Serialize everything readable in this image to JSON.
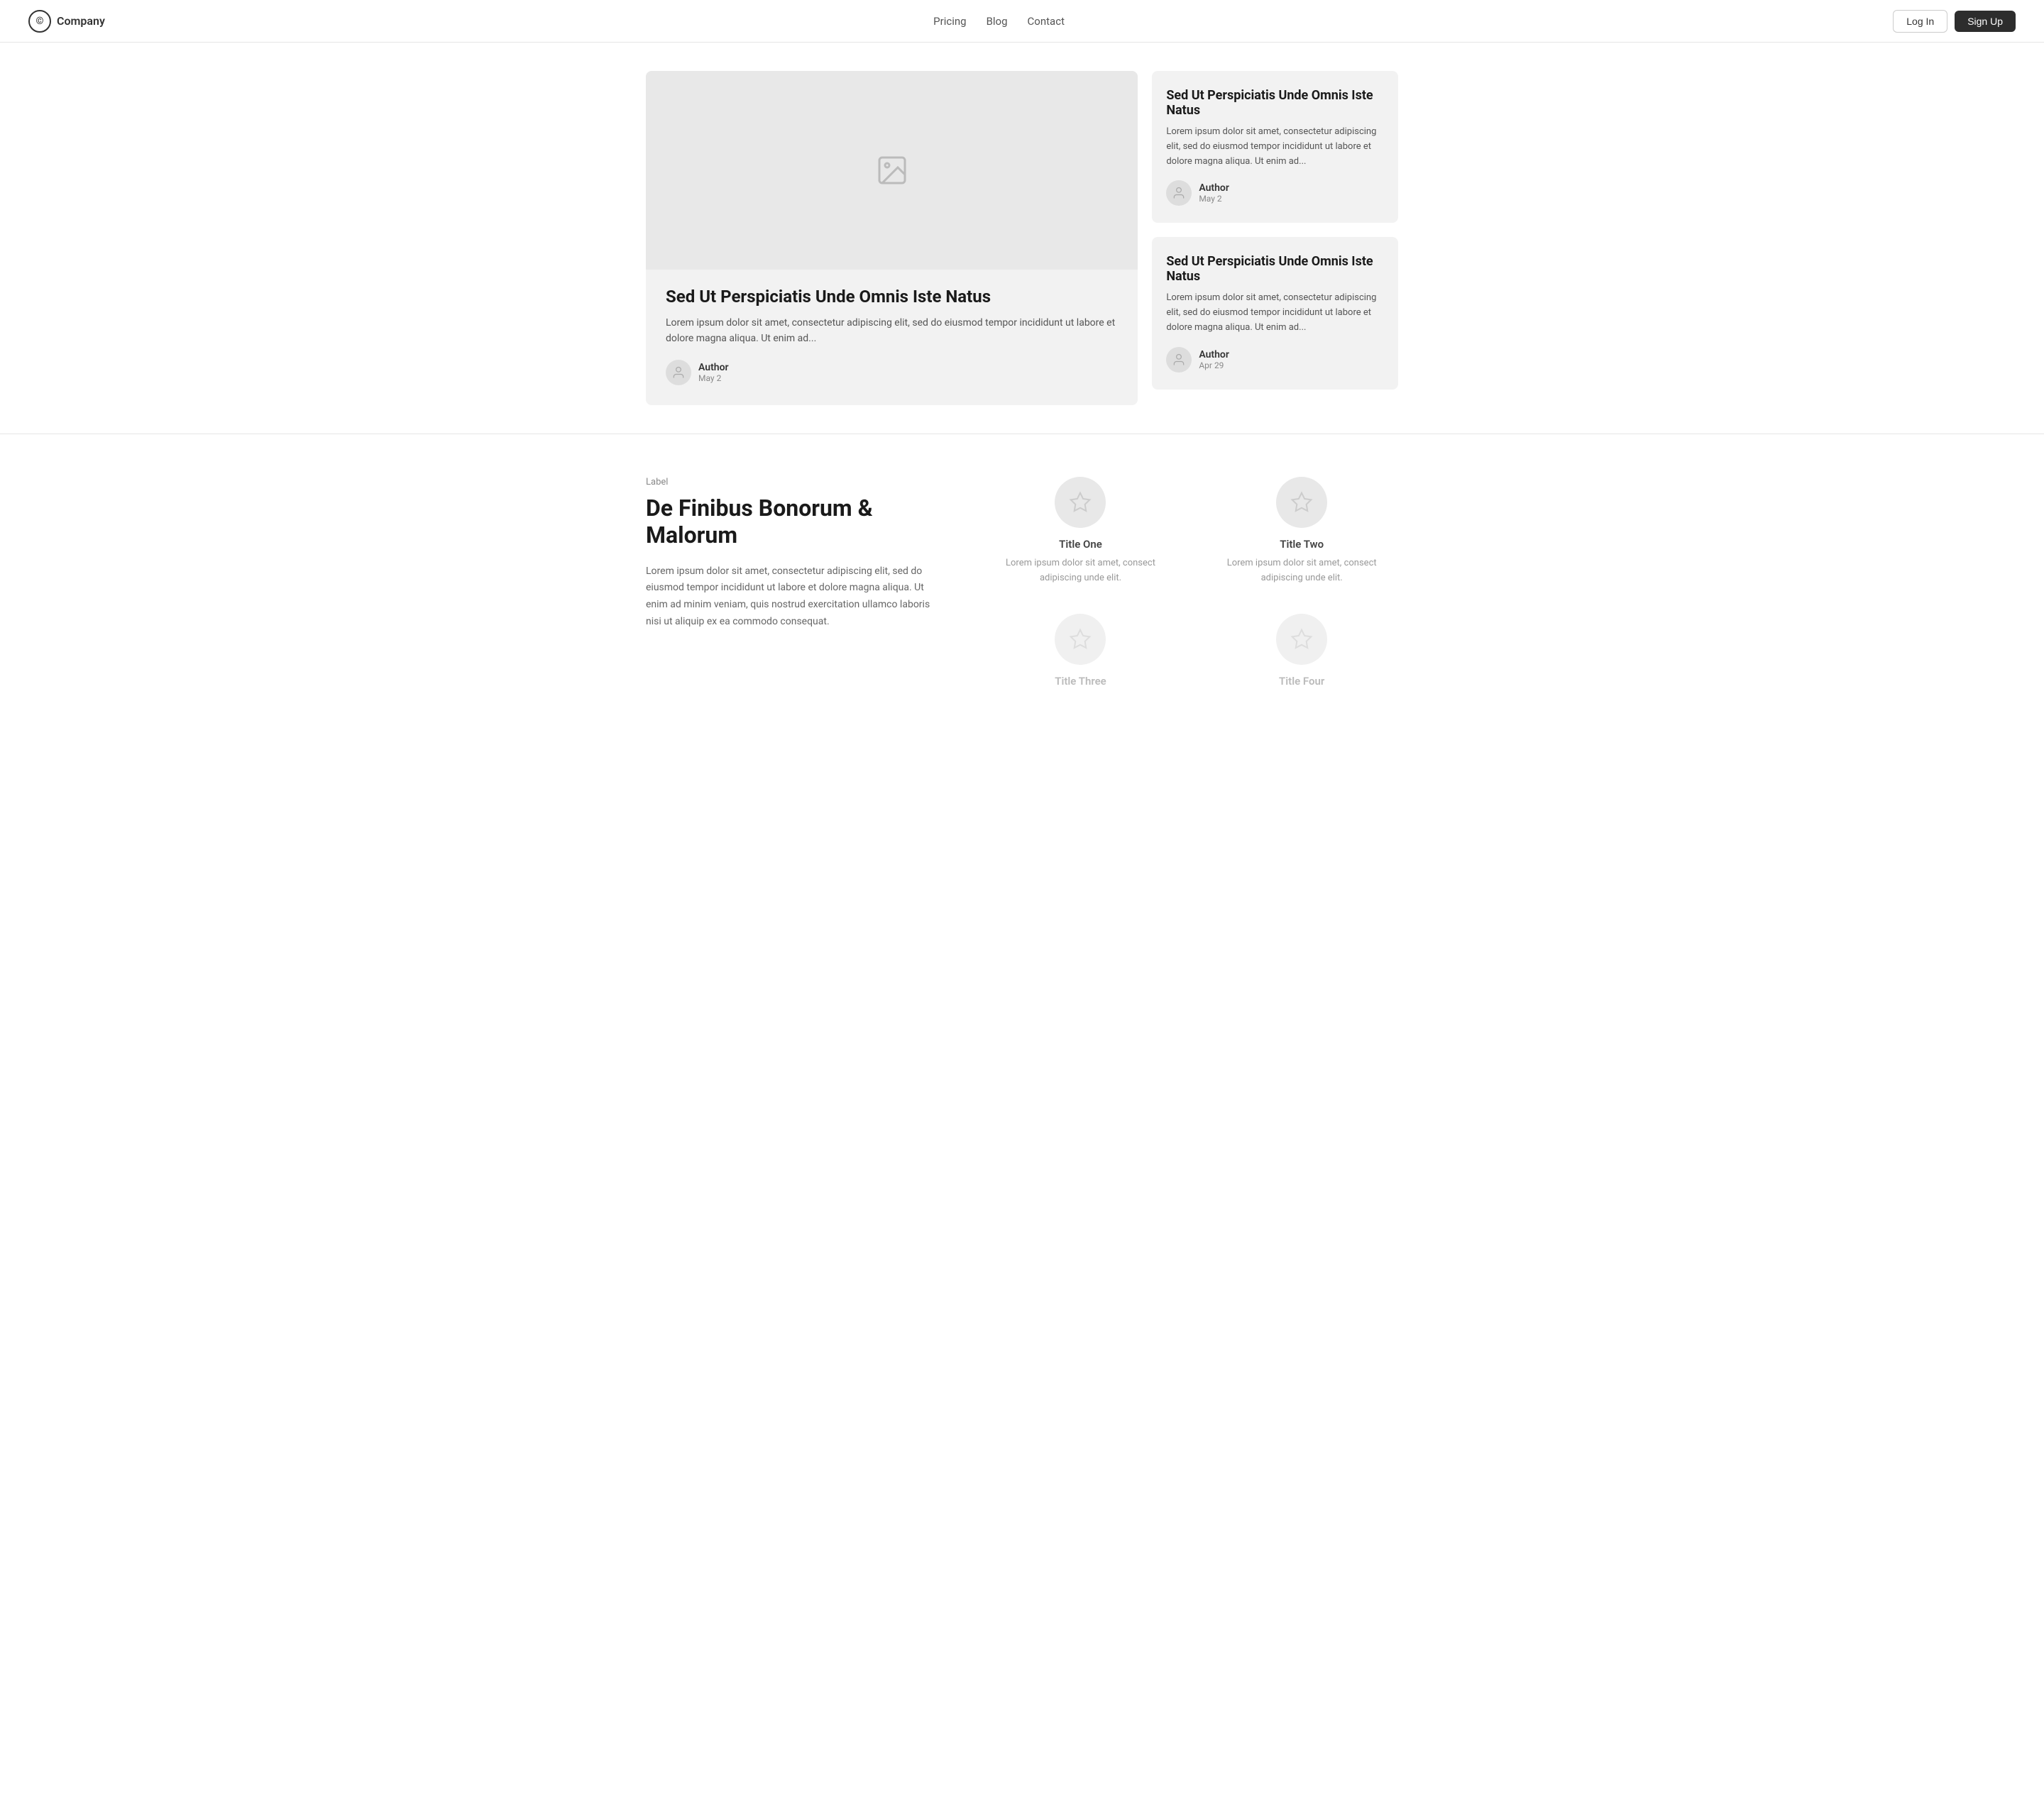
{
  "navbar": {
    "brand_icon": "©",
    "brand_name": "Company",
    "nav_links": [
      {
        "label": "Pricing",
        "id": "pricing"
      },
      {
        "label": "Blog",
        "id": "blog"
      },
      {
        "label": "Contact",
        "id": "contact"
      }
    ],
    "login_label": "Log In",
    "signup_label": "Sign Up"
  },
  "hero": {
    "main_card": {
      "title": "Sed Ut Perspiciatis Unde Omnis Iste Natus",
      "description": "Lorem ipsum dolor sit amet, consectetur adipiscing elit, sed do eiusmod tempor incididunt ut labore et dolore magna aliqua. Ut enim ad...",
      "author_name": "Author",
      "author_date": "May 2"
    },
    "side_card_1": {
      "title": "Sed Ut Perspiciatis Unde Omnis Iste Natus",
      "description": "Lorem ipsum dolor sit amet, consectetur adipiscing elit, sed do eiusmod tempor incididunt ut labore et dolore magna aliqua. Ut enim ad...",
      "author_name": "Author",
      "author_date": "May 2"
    },
    "side_card_2": {
      "title": "Sed Ut Perspiciatis Unde Omnis Iste Natus",
      "description": "Lorem ipsum dolor sit amet, consectetur adipiscing elit, sed do eiusmod tempor incididunt ut labore et dolore magna aliqua. Ut enim ad...",
      "author_name": "Author",
      "author_date": "Apr 29"
    }
  },
  "features": {
    "label": "Label",
    "title": "De Finibus Bonorum & Malorum",
    "description": "Lorem ipsum dolor sit amet, consectetur adipiscing elit, sed do eiusmod tempor incididunt ut labore et dolore magna aliqua. Ut enim ad minim veniam, quis nostrud exercitation ullamco laboris nisi ut aliquip ex ea commodo consequat.",
    "items": [
      {
        "id": "title-one",
        "title": "Title One",
        "description": "Lorem ipsum dolor sit amet, consect adipiscing unde elit.",
        "muted": false
      },
      {
        "id": "title-two",
        "title": "Title Two",
        "description": "Lorem ipsum dolor sit amet, consect adipiscing unde elit.",
        "muted": false
      },
      {
        "id": "title-three",
        "title": "Title Three",
        "description": "",
        "muted": true
      },
      {
        "id": "title-four",
        "title": "Title Four",
        "description": "",
        "muted": true
      }
    ]
  }
}
